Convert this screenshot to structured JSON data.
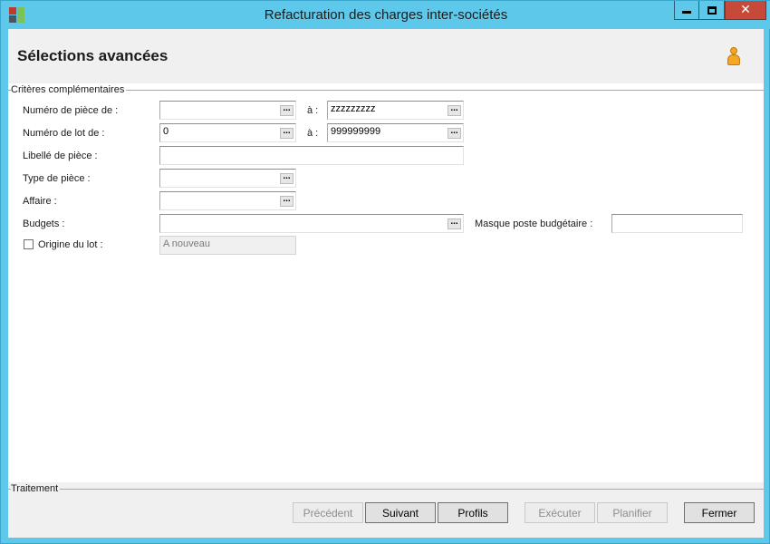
{
  "window": {
    "title": "Refacturation des charges inter-sociétés",
    "controls": {
      "minimize": "minimize-icon",
      "maximize": "maximize-icon",
      "close": "close-icon"
    }
  },
  "header": {
    "title": "Sélections avancées",
    "user_icon": "user-icon"
  },
  "criteria": {
    "group_label": "Critères complémentaires",
    "piece_from": {
      "label": "Numéro de pièce de :",
      "value": ""
    },
    "piece_to": {
      "label": "à :",
      "value": "zzzzzzzzz"
    },
    "lot_from": {
      "label": "Numéro de lot de :",
      "value": "0"
    },
    "lot_to": {
      "label": "à :",
      "value": "999999999"
    },
    "libelle": {
      "label": "Libellé de pièce :",
      "value": ""
    },
    "type_piece": {
      "label": "Type de pièce :",
      "value": ""
    },
    "affaire": {
      "label": "Affaire :",
      "value": ""
    },
    "budgets": {
      "label": "Budgets :",
      "value": ""
    },
    "masque": {
      "label": "Masque poste budgétaire :",
      "value": ""
    },
    "origine": {
      "label": "Origine du lot :",
      "checked": false,
      "value": "A nouveau"
    },
    "ellipsis": "..."
  },
  "footer": {
    "group_label": "Traitement",
    "buttons": {
      "precedent": "Précédent",
      "suivant": "Suivant",
      "profils": "Profils",
      "executer": "Exécuter",
      "planifier": "Planifier",
      "fermer": "Fermer"
    }
  },
  "colors": {
    "titlebar": "#5ec8ea",
    "close_button": "#c7493a",
    "panel_band": "#f0f0f0"
  }
}
